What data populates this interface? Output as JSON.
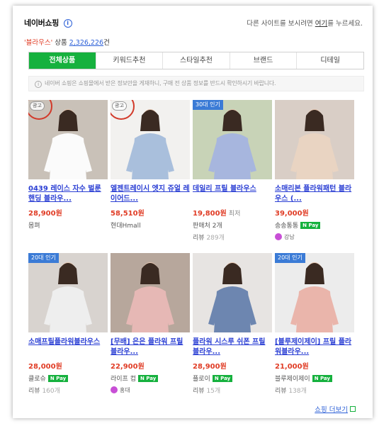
{
  "header": {
    "title": "네이버쇼핑",
    "info_icon": "i",
    "notice_pre": "다른 사이트를 보시려면 ",
    "notice_link": "여기",
    "notice_post": "를 누르세요."
  },
  "result": {
    "keyword": "'블라우스'",
    "label": " 상품 ",
    "count": "2,326,226",
    "suffix": "건"
  },
  "tabs": [
    {
      "label": "전체상품",
      "active": true
    },
    {
      "label": "키워드추천"
    },
    {
      "label": "스타일추천"
    },
    {
      "label": "브랜드"
    },
    {
      "label": "디테일"
    }
  ],
  "disclaimer": "네이버 쇼핑은 쇼핑몰에서 받은 정보만을 게재하니, 구매 전 상품 정보를 반드시 확인하시기 바랍니다.",
  "ad_label": "광고",
  "npay_label": "N Pay",
  "products": [
    {
      "name": "0439 레이스 자수 벌룬 핸딩 블라우...",
      "price": "28,900원",
      "seller": "몸펴",
      "badge": "",
      "ad": true,
      "img_bg": "#c9c1b8",
      "cloth": "#fbfbfb"
    },
    {
      "name": "엘젠트레이시 엣지 쥬얼 레이어드...",
      "price": "58,510원",
      "seller": "현대Hmall",
      "badge": "",
      "ad": true,
      "img_bg": "#f2f1ef",
      "cloth": "#a9bfdc"
    },
    {
      "name": "데일리 프릴 블라우스",
      "price": "19,800원",
      "lowest": "최저",
      "seller": "판매처 2개",
      "review": "리뷰",
      "review_count": "289개",
      "badge": "30대 인기",
      "img_bg": "#c8d3b7",
      "cloth": "#a7b6de"
    },
    {
      "name": "소매리본 플라워패턴 블라우스 (...",
      "price": "39,000원",
      "seller": "송송통통",
      "npay": true,
      "loc": "강남",
      "badge": "",
      "img_bg": "#d9cec6",
      "cloth": "#e9d4c2"
    },
    {
      "name": "소매프릴플라워블라우스",
      "price": "28,000원",
      "seller": "클로슈",
      "npay": true,
      "review": "리뷰",
      "review_count": "160개",
      "badge": "20대 인기",
      "img_bg": "#d8d3cf",
      "cloth": "#eeeeee"
    },
    {
      "name": "[무배] 은은 플라워 프릴 블라우...",
      "price": "22,900원",
      "seller": "라이프 컵",
      "npay": true,
      "loc": "홍대",
      "badge": "",
      "img_bg": "#b7a79c",
      "cloth": "#e6b8b5"
    },
    {
      "name": "플라워 시스루 쉬폰 프릴 블라우...",
      "price": "28,900원",
      "seller": "플로이",
      "npay": true,
      "review": "리뷰",
      "review_count": "15개",
      "badge": "",
      "img_bg": "#e7e4e2",
      "cloth": "#6d86b0"
    },
    {
      "name": "[블루제이제이] 프릴 플라워블라우...",
      "price": "21,000원",
      "seller": "블루제이제이",
      "npay": true,
      "review": "리뷰",
      "review_count": "138개",
      "badge": "20대 인기",
      "img_bg": "#ececec",
      "cloth": "#eab5ab"
    }
  ],
  "footer": {
    "more_label": "쇼핑 더보기"
  }
}
